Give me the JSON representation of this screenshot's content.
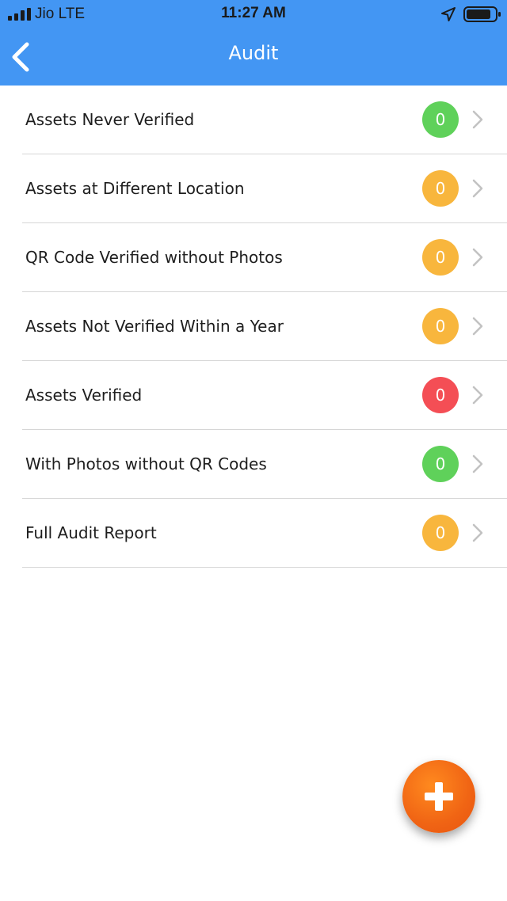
{
  "status_bar": {
    "carrier": "Jio  LTE",
    "time": "11:27 AM",
    "icons": [
      "signal-icon",
      "location-arrow-icon",
      "battery-icon"
    ]
  },
  "header": {
    "title": "Audit",
    "back_icon": "chevron-left-icon",
    "background_color": "#4396f3"
  },
  "audit_items": [
    {
      "label": "Assets Never Verified",
      "count": "0",
      "badge_color": "#5fd15a"
    },
    {
      "label": "Assets at Different Location",
      "count": "0",
      "badge_color": "#f8b63d"
    },
    {
      "label": "QR Code Verified without Photos",
      "count": "0",
      "badge_color": "#f8b63d"
    },
    {
      "label": "Assets Not Verified Within a Year",
      "count": "0",
      "badge_color": "#f8b63d"
    },
    {
      "label": "Assets Verified",
      "count": "0",
      "badge_color": "#f44e55"
    },
    {
      "label": "With Photos without QR Codes",
      "count": "0",
      "badge_color": "#5fd15a"
    },
    {
      "label": "Full Audit Report",
      "count": "0",
      "badge_color": "#f8b63d"
    }
  ],
  "fab": {
    "icon": "plus-icon",
    "color": "#f06414"
  }
}
